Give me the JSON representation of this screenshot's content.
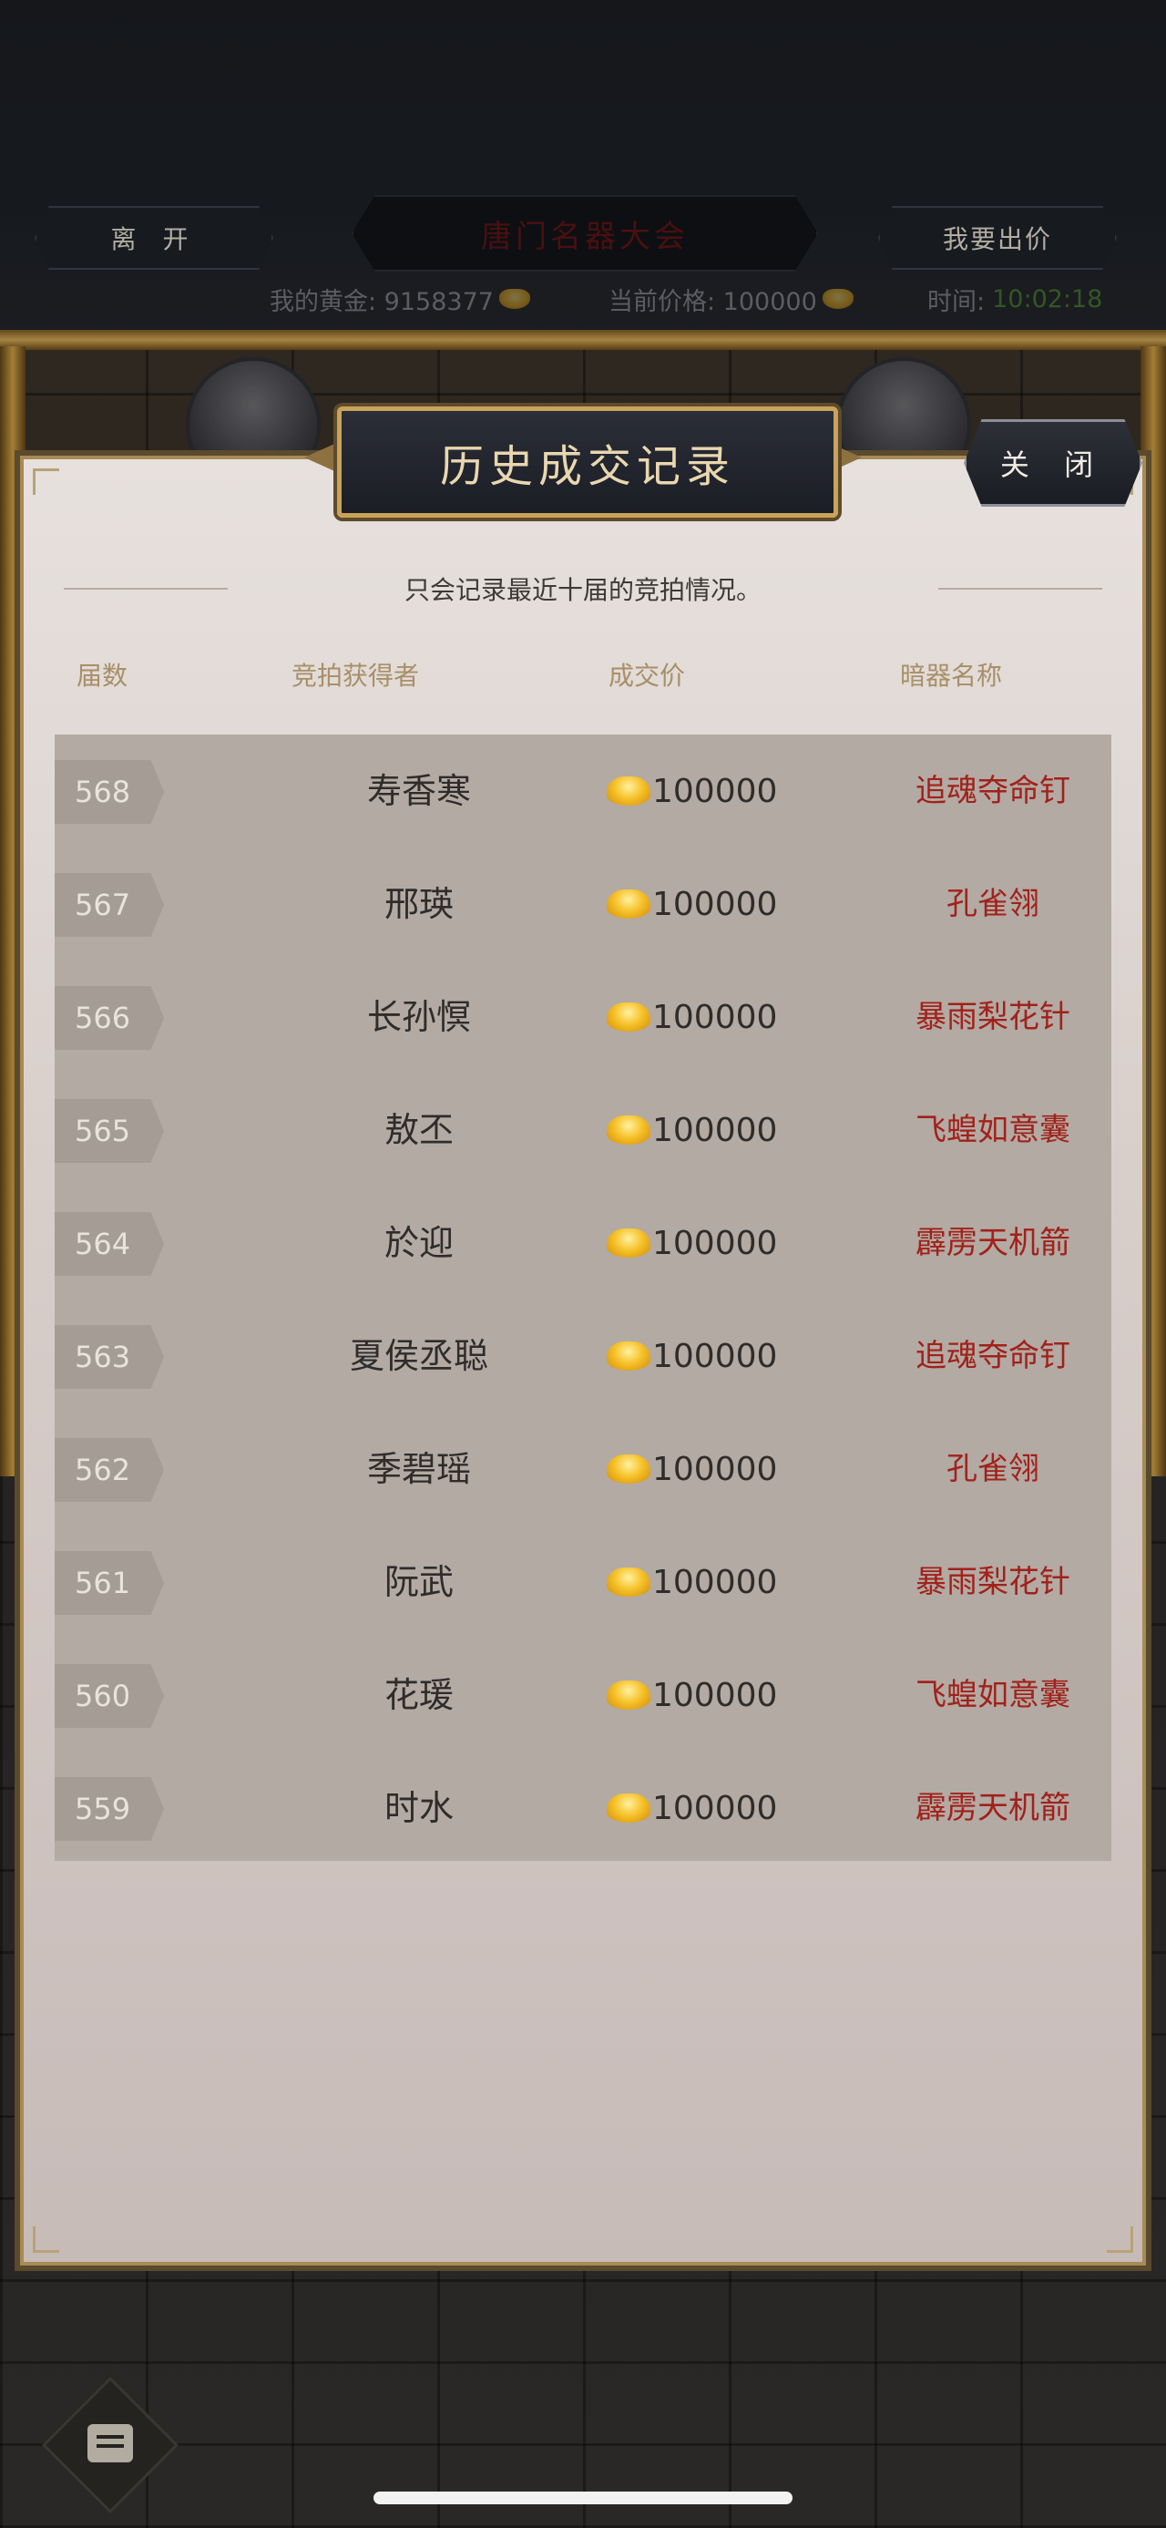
{
  "header": {
    "leave_label": "离 开",
    "title": "唐门名器大会",
    "bid_label": "我要出价"
  },
  "status": {
    "gold_label": "我的黄金: 9158377",
    "price_label": "当前价格: 100000",
    "time_label": "时间:",
    "time_value": "10:02:18"
  },
  "modal": {
    "title": "历史成交记录",
    "close_label": "关 闭",
    "note": "只会记录最近十届的竞拍情况。",
    "columns": {
      "session": "届数",
      "winner": "竞拍获得者",
      "price": "成交价",
      "weapon": "暗器名称"
    },
    "rows": [
      {
        "session": "568",
        "winner": "寿香寒",
        "price": "100000",
        "weapon": "追魂夺命钉"
      },
      {
        "session": "567",
        "winner": "邢瑛",
        "price": "100000",
        "weapon": "孔雀翎"
      },
      {
        "session": "566",
        "winner": "长孙慏",
        "price": "100000",
        "weapon": "暴雨梨花针"
      },
      {
        "session": "565",
        "winner": "敖丕",
        "price": "100000",
        "weapon": "飞蝗如意囊"
      },
      {
        "session": "564",
        "winner": "於迎",
        "price": "100000",
        "weapon": "霹雳天机箭"
      },
      {
        "session": "563",
        "winner": "夏侯丞聪",
        "price": "100000",
        "weapon": "追魂夺命钉"
      },
      {
        "session": "562",
        "winner": "季碧瑶",
        "price": "100000",
        "weapon": "孔雀翎"
      },
      {
        "session": "561",
        "winner": "阮武",
        "price": "100000",
        "weapon": "暴雨梨花针"
      },
      {
        "session": "560",
        "winner": "花瑗",
        "price": "100000",
        "weapon": "飞蝗如意囊"
      },
      {
        "session": "559",
        "winner": "时水",
        "price": "100000",
        "weapon": "霹雳天机箭"
      }
    ]
  },
  "colors": {
    "weapon_text": "#a1211b",
    "time_text": "#3d6b2c",
    "header_gold": "#c9a35a"
  },
  "icons": [
    "gold-coin-icon",
    "gold-ingot-icon",
    "chat-icon"
  ]
}
